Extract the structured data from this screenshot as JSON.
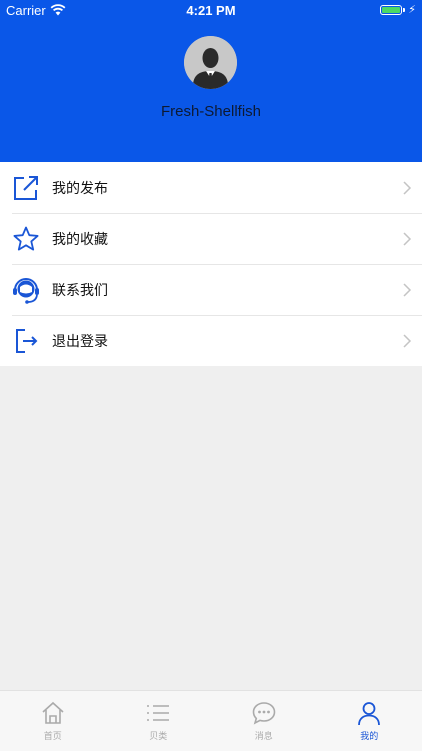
{
  "status_bar": {
    "carrier": "Carrier",
    "time": "4:21 PM"
  },
  "profile": {
    "username": "Fresh-Shellfish"
  },
  "menu": {
    "items": [
      {
        "label": "我的发布",
        "icon": "share-export-icon"
      },
      {
        "label": "我的收藏",
        "icon": "star-icon"
      },
      {
        "label": "联系我们",
        "icon": "customer-service-icon"
      },
      {
        "label": "退出登录",
        "icon": "logout-icon"
      }
    ]
  },
  "tabbar": {
    "tabs": [
      {
        "label": "首页",
        "icon": "home-icon",
        "active": false
      },
      {
        "label": "贝类",
        "icon": "list-icon",
        "active": false
      },
      {
        "label": "消息",
        "icon": "chat-bubble-icon",
        "active": false
      },
      {
        "label": "我的",
        "icon": "user-icon",
        "active": true
      }
    ]
  },
  "colors": {
    "header_bg": "#0a57e8",
    "accent": "#1a56d6",
    "page_bg": "#efefef",
    "battery": "#4cd964",
    "tab_inactive": "#aaaaaa"
  }
}
